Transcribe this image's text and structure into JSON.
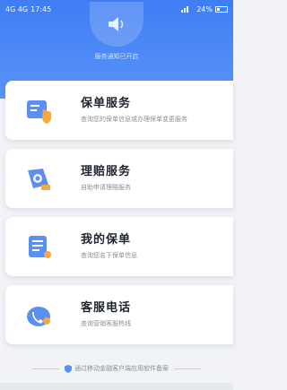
{
  "status_bar": {
    "carrier": "4G 4G",
    "time": "17:45",
    "battery": "24%"
  },
  "header": {
    "notice": "服务通知已开启"
  },
  "cards": [
    {
      "title": "保单服务",
      "subtitle": "查询您的保单信息或办理保单变更服务",
      "icon": "policy-service-icon"
    },
    {
      "title": "理赔服务",
      "subtitle": "自助申请理赔服务",
      "icon": "claim-service-icon"
    },
    {
      "title": "我的保单",
      "subtitle": "查询您名下保单信息",
      "icon": "my-policy-icon"
    },
    {
      "title": "客服电话",
      "subtitle": "查询营销客服热线",
      "icon": "customer-service-phone-icon"
    }
  ],
  "footer": {
    "text": "通过移动金融客户端应用软件备案"
  },
  "colors": {
    "header_blue": "#3f7df4",
    "accent_orange": "#f5a742",
    "icon_blue": "#5b8ff0"
  }
}
